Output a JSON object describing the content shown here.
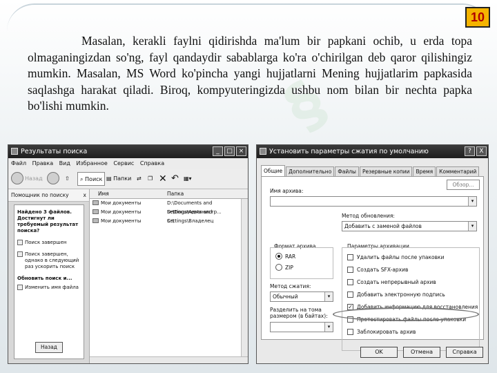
{
  "slide": {
    "page_number": "10",
    "paragraph": "Masalan, kerakli faylni qidirishda ma'lum bir papkani ochib, u erda topa olmaganingizdan so'ng, fayl qandaydir sabablarga ko'ra o'chirilgan deb qaror qilishingiz mumkin. Masalan, MS Word ko'pincha yangi hujjatlarni Mening hujjatlarim papkasida saqlashga harakat qiladi. Biroq, kompyuteringizda ushbu nom bilan bir nechta papka bo'lishi mumkin."
  },
  "search_window": {
    "title": "Результаты поиска",
    "menu": [
      "Файл",
      "Правка",
      "Вид",
      "Избранное",
      "Сервис",
      "Справка"
    ],
    "toolbar": {
      "back": "Назад",
      "search": "Поиск",
      "folders": "Папки"
    },
    "panel_title": "Помощник по поиску",
    "panel_close": "x",
    "found_text": "Найдено 3 файлов. Достигнут ли требуемый результат поиска?",
    "options": [
      "Поиск завершен",
      "Поиск завершен, однако в следующий раз ускорить поиск"
    ],
    "refine_title": "Обновить поиск и...",
    "refine_option": "Изменить имя файла",
    "back_button": "Назад",
    "columns": {
      "name": "Имя",
      "folder": "Папка"
    },
    "rows": [
      {
        "name": "Мои документы",
        "folder": "D:\\Documents and Settings\\Администр..."
      },
      {
        "name": "Мои документы",
        "folder": "D:\\Documents and Settings\\Владелец"
      },
      {
        "name": "Мои документы",
        "folder": "C:\\"
      }
    ]
  },
  "archive_dialog": {
    "title": "Установить параметры сжатия по умолчанию",
    "help": "?",
    "close": "X",
    "tabs": [
      "Общие",
      "Дополнительно",
      "Файлы",
      "Резервные копии",
      "Время",
      "Комментарий"
    ],
    "archive_name_label": "Имя архива:",
    "browse_button": "Обзор...",
    "update_method_label": "Метод обновления:",
    "update_method_value": "Добавить с заменой файлов",
    "format_label": "Формат архива",
    "formats": [
      "RAR",
      "ZIP"
    ],
    "selected_format": "RAR",
    "params_label": "Параметры архивации",
    "params": [
      {
        "label": "Удалить файлы после упаковки",
        "checked": false
      },
      {
        "label": "Создать SFX-архив",
        "checked": false
      },
      {
        "label": "Создать непрерывный архив",
        "checked": false
      },
      {
        "label": "Добавить электронную подпись",
        "checked": false
      },
      {
        "label": "Добавить информацию для восстановления",
        "checked": true
      },
      {
        "label": "Протестировать файлы после упаковки",
        "checked": false
      },
      {
        "label": "Заблокировать архив",
        "checked": false
      }
    ],
    "compression_label": "Метод сжатия:",
    "compression_value": "Обычный",
    "split_label": "Разделить на тома размером (в байтах):",
    "ok": "OK",
    "cancel": "Отмена",
    "help_button": "Справка"
  },
  "colors": {
    "page_badge": "#f5b400",
    "page_badge_text": "#b00000"
  }
}
